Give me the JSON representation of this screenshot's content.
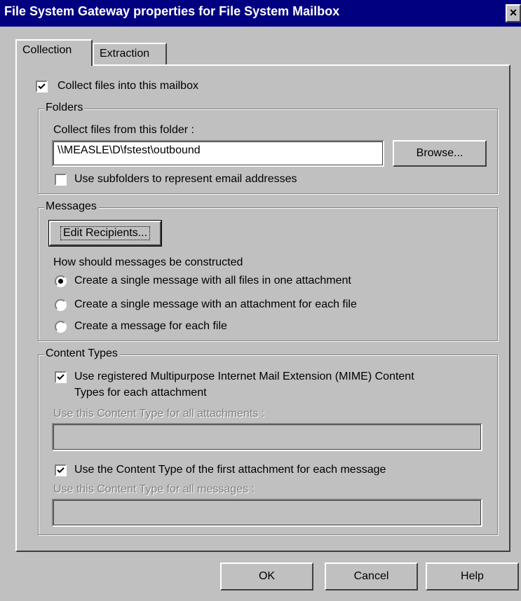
{
  "dialog": {
    "title": "File System Gateway properties for File System Mailbox",
    "close_glyph": "×"
  },
  "tabs": [
    {
      "label": "Collection",
      "selected": true
    },
    {
      "label": "Extraction",
      "selected": false
    }
  ],
  "collection": {
    "collect_files_label": "Collect files into this mailbox",
    "collect_files_checked": true
  },
  "folders": {
    "legend": "Folders",
    "folder_label": "Collect files from this folder :",
    "folder_value": "\\\\MEASLE\\D\\fstest\\outbound",
    "browse_label": "Browse...",
    "subfolders_label": "Use subfolders to represent email addresses",
    "subfolders_checked": false
  },
  "messages": {
    "legend": "Messages",
    "edit_recipients_label": "Edit Recipients...",
    "construct_label": "How should messages be constructed",
    "options": [
      {
        "label": "Create a single message with all files in one attachment",
        "selected": true
      },
      {
        "label": "Create a single message with an attachment for each file",
        "selected": false
      },
      {
        "label": "Create a message for each file",
        "selected": false
      }
    ]
  },
  "content_types": {
    "legend": "Content Types",
    "mime_label_line1": "Use registered Multipurpose Internet Mail Extension (MIME) Content",
    "mime_label_line2": "Types for each attachment",
    "mime_checked": true,
    "attachments_field_label": "Use this Content Type for all attachments :",
    "attachments_field_value": "",
    "first_attachment_label": "Use the Content Type of the first attachment for each message",
    "first_attachment_checked": true,
    "messages_field_label": "Use this Content Type for all messages :",
    "messages_field_value": ""
  },
  "footer": {
    "ok_label": "OK",
    "cancel_label": "Cancel",
    "help_label": "Help"
  },
  "icons": [
    "close-icon",
    "checkmark-icon",
    "radio-dot-icon"
  ],
  "colors": {
    "title_bar": "#000080",
    "dialog_face": "#c0c0c0",
    "disabled_text": "#808080"
  }
}
